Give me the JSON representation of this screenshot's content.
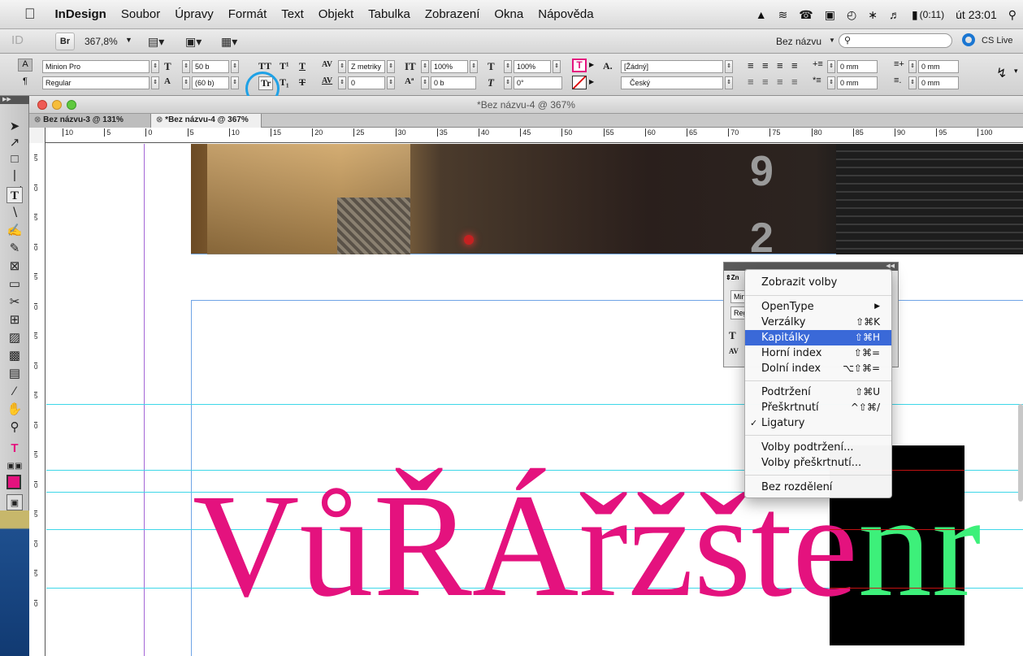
{
  "menubar": {
    "app_name": "InDesign",
    "items": [
      "Soubor",
      "Úpravy",
      "Formát",
      "Text",
      "Objekt",
      "Tabulka",
      "Zobrazení",
      "Okna",
      "Nápověda"
    ],
    "battery": "(0:11)",
    "clock": "út 23:01"
  },
  "appbar": {
    "bridge": "Br",
    "zoom": "367,8%",
    "doc_name": "Bez názvu",
    "cs_live": "CS Live"
  },
  "control": {
    "font_family": "Minion Pro",
    "font_style": "Regular",
    "font_size": "50 b",
    "leading": "(60 b)",
    "kerning": "Z metriky",
    "tracking": "0",
    "v_scale": "100%",
    "baseline": "0 b",
    "h_scale": "100%",
    "skew": "0°",
    "char_style": "[Žádný]",
    "language": "Český",
    "indent_left": "0 mm",
    "indent_first": "0 mm",
    "indent_right": "0 mm",
    "indent_last": "0 mm"
  },
  "window": {
    "title": "*Bez názvu-4 @ 367%",
    "tabs": [
      "Bez názvu-3 @ 131%",
      "*Bez názvu-4 @ 367%"
    ]
  },
  "rulers": {
    "h_ticks": [
      "10",
      "5",
      "0",
      "5",
      "10",
      "15",
      "20",
      "25",
      "30",
      "35",
      "40",
      "45",
      "50",
      "55",
      "60",
      "65",
      "70",
      "75",
      "80",
      "85",
      "90",
      "95",
      "100"
    ],
    "v_ticks": [
      "5",
      "0",
      "5",
      "0",
      "5",
      "0",
      "5",
      "0",
      "5",
      "0",
      "5",
      "0",
      "5",
      "0",
      "5",
      "0"
    ]
  },
  "document": {
    "text_pink": "VůŘÁřžšte",
    "text_green": "nr",
    "photo_digits": [
      "9",
      "2"
    ]
  },
  "char_panel": {
    "title": "Zn",
    "font": "Min",
    "style": "Reg"
  },
  "context_menu": {
    "show_options": "Zobrazit volby",
    "opentype": "OpenType",
    "caps": "Verzálky",
    "caps_sc": "⇧⌘K",
    "small_caps": "Kapitálky",
    "small_caps_sc": "⇧⌘H",
    "superscript": "Horní index",
    "superscript_sc": "⇧⌘=",
    "subscript": "Dolní index",
    "subscript_sc": "⌥⇧⌘=",
    "underline": "Podtržení",
    "underline_sc": "⇧⌘U",
    "strikethrough": "Přeškrtnutí",
    "strikethrough_sc": "^⇧⌘/",
    "ligatures": "Ligatury",
    "ligatures_check": "✓",
    "underline_opts": "Volby podtržení...",
    "strike_opts": "Volby přeškrtnutí...",
    "no_break": "Bez rozdělení",
    "highlight": "#3a69d8"
  },
  "colors": {
    "text_pink": "#e4127e",
    "text_green": "#3df07a",
    "guide": "#3ed7e8",
    "annotation_circle": "#1ea1e6"
  }
}
